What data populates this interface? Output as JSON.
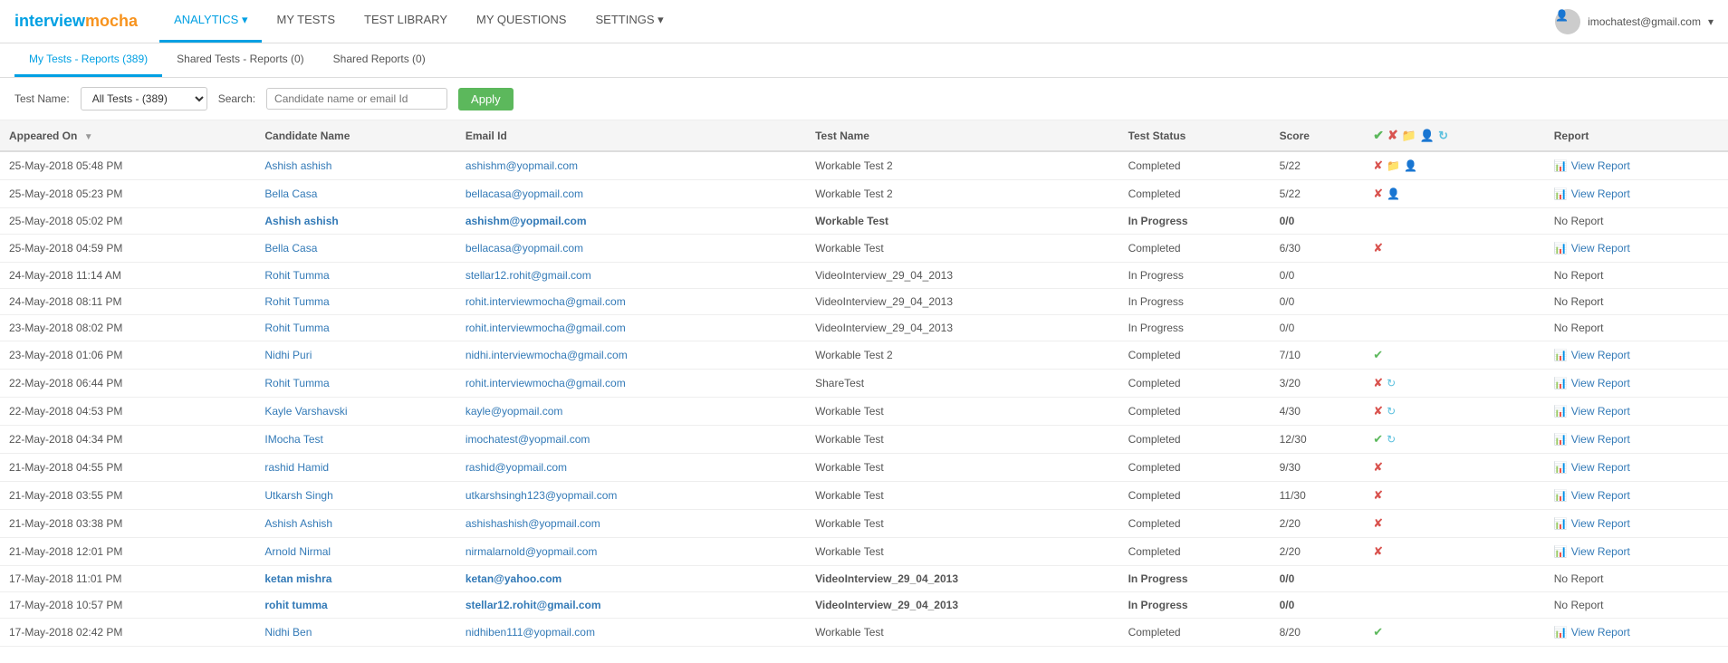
{
  "logo": {
    "interview": "interview",
    "mocha": "mocha"
  },
  "nav": {
    "items": [
      {
        "id": "analytics",
        "label": "ANALYTICS",
        "active": true,
        "hasDropdown": true
      },
      {
        "id": "my-tests",
        "label": "MY TESTS",
        "active": false
      },
      {
        "id": "test-library",
        "label": "TEST LIBRARY",
        "active": false
      },
      {
        "id": "my-questions",
        "label": "MY QUESTIONS",
        "active": false
      },
      {
        "id": "settings",
        "label": "SETTINGS",
        "active": false,
        "hasDropdown": true
      }
    ],
    "user": "imochatest@gmail.com"
  },
  "tabs": [
    {
      "id": "my-tests-reports",
      "label": "My Tests - Reports (389)",
      "active": true
    },
    {
      "id": "shared-tests-reports",
      "label": "Shared Tests - Reports (0)",
      "active": false
    },
    {
      "id": "shared-reports",
      "label": "Shared Reports (0)",
      "active": false
    }
  ],
  "filter": {
    "test_name_label": "Test Name:",
    "test_name_value": "All Tests - (389)",
    "test_name_options": [
      "All Tests - (389)"
    ],
    "search_label": "Search:",
    "search_placeholder": "Candidate name or email Id",
    "apply_label": "Apply"
  },
  "table": {
    "columns": [
      {
        "id": "appeared-on",
        "label": "Appeared On",
        "sortable": true
      },
      {
        "id": "candidate-name",
        "label": "Candidate Name",
        "sortable": false
      },
      {
        "id": "email-id",
        "label": "Email Id",
        "sortable": false
      },
      {
        "id": "test-name",
        "label": "Test Name",
        "sortable": false
      },
      {
        "id": "test-status",
        "label": "Test Status",
        "sortable": false
      },
      {
        "id": "score",
        "label": "Score",
        "sortable": false
      },
      {
        "id": "actions",
        "label": "",
        "sortable": false
      },
      {
        "id": "report",
        "label": "Report",
        "sortable": false
      }
    ],
    "header_icons": [
      "check",
      "x",
      "folder",
      "user",
      "refresh"
    ],
    "rows": [
      {
        "appeared_on": "25-May-2018 05:48 PM",
        "candidate_name": "Ashish ashish",
        "email": "ashishm@yopmail.com",
        "test_name": "Workable Test 2",
        "test_status": "Completed",
        "score": "5/22",
        "bold": false,
        "icons": [
          "x",
          "folder",
          "user"
        ],
        "report_type": "view",
        "report_label": "View Report"
      },
      {
        "appeared_on": "25-May-2018 05:23 PM",
        "candidate_name": "Bella Casa",
        "email": "bellacasa@yopmail.com",
        "test_name": "Workable Test 2",
        "test_status": "Completed",
        "score": "5/22",
        "bold": false,
        "icons": [
          "x",
          "user"
        ],
        "report_type": "view",
        "report_label": "View Report"
      },
      {
        "appeared_on": "25-May-2018 05:02 PM",
        "candidate_name": "Ashish ashish",
        "email": "ashishm@yopmail.com",
        "test_name": "Workable Test",
        "test_status": "In Progress",
        "score": "0/0",
        "bold": true,
        "icons": [],
        "report_type": "none",
        "report_label": "No Report"
      },
      {
        "appeared_on": "25-May-2018 04:59 PM",
        "candidate_name": "Bella Casa",
        "email": "bellacasa@yopmail.com",
        "test_name": "Workable Test",
        "test_status": "Completed",
        "score": "6/30",
        "bold": false,
        "icons": [
          "x"
        ],
        "report_type": "view",
        "report_label": "View Report"
      },
      {
        "appeared_on": "24-May-2018 11:14 AM",
        "candidate_name": "Rohit Tumma",
        "email": "stellar12.rohit@gmail.com",
        "test_name": "VideoInterview_29_04_2013",
        "test_status": "In Progress",
        "score": "0/0",
        "bold": false,
        "icons": [],
        "report_type": "none",
        "report_label": "No Report"
      },
      {
        "appeared_on": "24-May-2018 08:11 PM",
        "candidate_name": "Rohit Tumma",
        "email": "rohit.interviewmocha@gmail.com",
        "test_name": "VideoInterview_29_04_2013",
        "test_status": "In Progress",
        "score": "0/0",
        "bold": false,
        "icons": [],
        "report_type": "none",
        "report_label": "No Report"
      },
      {
        "appeared_on": "23-May-2018 08:02 PM",
        "candidate_name": "Rohit Tumma",
        "email": "rohit.interviewmocha@gmail.com",
        "test_name": "VideoInterview_29_04_2013",
        "test_status": "In Progress",
        "score": "0/0",
        "bold": false,
        "icons": [],
        "report_type": "none",
        "report_label": "No Report"
      },
      {
        "appeared_on": "23-May-2018 01:06 PM",
        "candidate_name": "Nidhi Puri",
        "email": "nidhi.interviewmocha@gmail.com",
        "test_name": "Workable Test 2",
        "test_status": "Completed",
        "score": "7/10",
        "bold": false,
        "icons": [
          "check"
        ],
        "report_type": "view",
        "report_label": "View Report"
      },
      {
        "appeared_on": "22-May-2018 06:44 PM",
        "candidate_name": "Rohit Tumma",
        "email": "rohit.interviewmocha@gmail.com",
        "test_name": "ShareTest",
        "test_status": "Completed",
        "score": "3/20",
        "bold": false,
        "icons": [
          "x",
          "refresh"
        ],
        "report_type": "view",
        "report_label": "View Report"
      },
      {
        "appeared_on": "22-May-2018 04:53 PM",
        "candidate_name": "Kayle Varshavski",
        "email": "kayle@yopmail.com",
        "test_name": "Workable Test",
        "test_status": "Completed",
        "score": "4/30",
        "bold": false,
        "icons": [
          "x",
          "refresh"
        ],
        "report_type": "view",
        "report_label": "View Report"
      },
      {
        "appeared_on": "22-May-2018 04:34 PM",
        "candidate_name": "IMocha Test",
        "email": "imochatest@yopmail.com",
        "test_name": "Workable Test",
        "test_status": "Completed",
        "score": "12/30",
        "bold": false,
        "icons": [
          "check",
          "refresh"
        ],
        "report_type": "view",
        "report_label": "View Report"
      },
      {
        "appeared_on": "21-May-2018 04:55 PM",
        "candidate_name": "rashid Hamid",
        "email": "rashid@yopmail.com",
        "test_name": "Workable Test",
        "test_status": "Completed",
        "score": "9/30",
        "bold": false,
        "icons": [
          "x"
        ],
        "report_type": "view",
        "report_label": "View Report"
      },
      {
        "appeared_on": "21-May-2018 03:55 PM",
        "candidate_name": "Utkarsh Singh",
        "email": "utkarshsingh123@yopmail.com",
        "test_name": "Workable Test",
        "test_status": "Completed",
        "score": "11/30",
        "bold": false,
        "icons": [
          "x"
        ],
        "report_type": "view",
        "report_label": "View Report"
      },
      {
        "appeared_on": "21-May-2018 03:38 PM",
        "candidate_name": "Ashish Ashish",
        "email": "ashishashish@yopmail.com",
        "test_name": "Workable Test",
        "test_status": "Completed",
        "score": "2/20",
        "bold": false,
        "icons": [
          "x"
        ],
        "report_type": "view",
        "report_label": "View Report"
      },
      {
        "appeared_on": "21-May-2018 12:01 PM",
        "candidate_name": "Arnold Nirmal",
        "email": "nirmalarnold@yopmail.com",
        "test_name": "Workable Test",
        "test_status": "Completed",
        "score": "2/20",
        "bold": false,
        "icons": [
          "x"
        ],
        "report_type": "view",
        "report_label": "View Report"
      },
      {
        "appeared_on": "17-May-2018 11:01 PM",
        "candidate_name": "ketan mishra",
        "email": "ketan@yahoo.com",
        "test_name": "VideoInterview_29_04_2013",
        "test_status": "In Progress",
        "score": "0/0",
        "bold": true,
        "icons": [],
        "report_type": "none",
        "report_label": "No Report"
      },
      {
        "appeared_on": "17-May-2018 10:57 PM",
        "candidate_name": "rohit tumma",
        "email": "stellar12.rohit@gmail.com",
        "test_name": "VideoInterview_29_04_2013",
        "test_status": "In Progress",
        "score": "0/0",
        "bold": true,
        "icons": [],
        "report_type": "none",
        "report_label": "No Report"
      },
      {
        "appeared_on": "17-May-2018 02:42 PM",
        "candidate_name": "Nidhi Ben",
        "email": "nidhiben111@yopmail.com",
        "test_name": "Workable Test",
        "test_status": "Completed",
        "score": "8/20",
        "bold": false,
        "icons": [
          "check"
        ],
        "report_type": "view",
        "report_label": "View Report"
      }
    ]
  }
}
